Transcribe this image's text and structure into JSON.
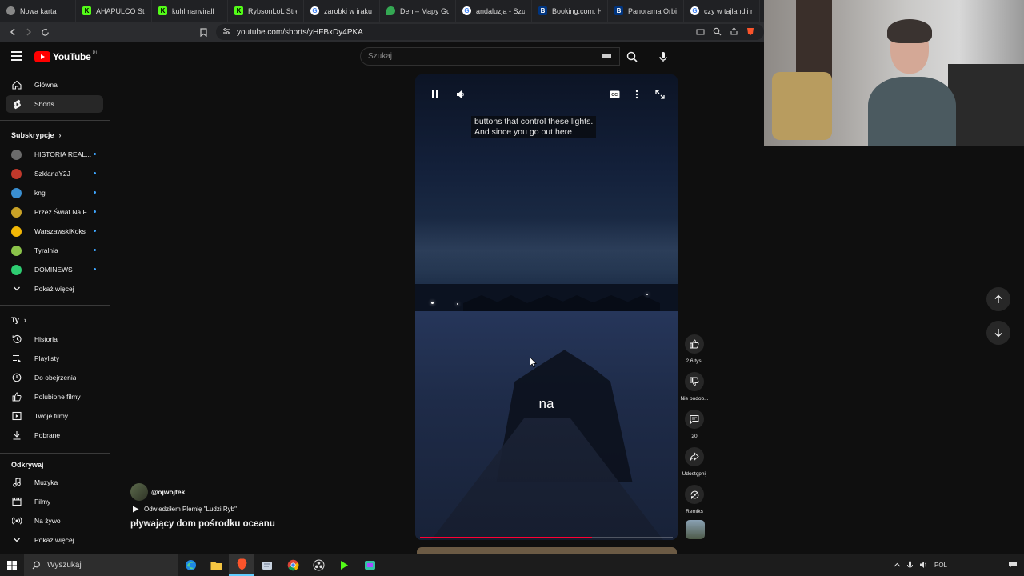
{
  "browser": {
    "tabs": [
      {
        "label": "Nowa karta",
        "icon": "brave-shield-icon"
      },
      {
        "label": "AHAPULCO Strea",
        "icon": "kick-icon"
      },
      {
        "label": "kuhlmanvirall",
        "icon": "kick-icon"
      },
      {
        "label": "RybsonLoL Strea",
        "icon": "kick-icon"
      },
      {
        "label": "zarobki w iraku -",
        "icon": "google-icon"
      },
      {
        "label": "Den – Mapy Goo",
        "icon": "maps-icon"
      },
      {
        "label": "andaluzja - Szuk",
        "icon": "google-icon"
      },
      {
        "label": "Booking.com: Ho",
        "icon": "booking-icon"
      },
      {
        "label": "Panorama Orbi C",
        "icon": "booking-icon"
      },
      {
        "label": "czy w tajlandii mo",
        "icon": "google-icon"
      }
    ],
    "url": "youtube.com/shorts/yHFBxDy4PKA"
  },
  "header": {
    "logo_text": "YouTube",
    "region": "PL",
    "search_placeholder": "Szukaj"
  },
  "sidebar": {
    "main": [
      {
        "label": "Główna",
        "icon": "home-icon"
      },
      {
        "label": "Shorts",
        "icon": "shorts-icon"
      }
    ],
    "subscriptions_title": "Subskrypcje",
    "subscriptions": [
      {
        "label": "HISTORIA REAL...",
        "color": "#6b6b6b"
      },
      {
        "label": "SzklanaY2J",
        "color": "#c0392b"
      },
      {
        "label": "kng",
        "color": "#3a8fd1"
      },
      {
        "label": "Przez Świat Na F...",
        "color": "#c9a227"
      },
      {
        "label": "WarszawskiKoks",
        "color": "#f2b705"
      },
      {
        "label": "Tyralnia",
        "color": "#8bc34a"
      },
      {
        "label": "DOMINEWS",
        "color": "#2ecc71"
      }
    ],
    "show_more_1": "Pokaż więcej",
    "you_title": "Ty",
    "you": [
      {
        "label": "Historia",
        "icon": "history-icon"
      },
      {
        "label": "Playlisty",
        "icon": "playlist-icon"
      },
      {
        "label": "Do obejrzenia",
        "icon": "clock-icon"
      },
      {
        "label": "Polubione filmy",
        "icon": "thumb-up-icon"
      },
      {
        "label": "Twoje filmy",
        "icon": "video-icon"
      },
      {
        "label": "Pobrane",
        "icon": "download-icon"
      }
    ],
    "explore_title": "Odkrywaj",
    "explore": [
      {
        "label": "Muzyka",
        "icon": "music-icon"
      },
      {
        "label": "Filmy",
        "icon": "film-icon"
      },
      {
        "label": "Na żywo",
        "icon": "live-icon"
      }
    ],
    "show_more_2": "Pokaż więcej"
  },
  "player": {
    "caption_top_line1": "buttons that control these lights.",
    "caption_top_line2": "And since you go out here",
    "caption_mid": "na",
    "progress": 0.68
  },
  "actions": {
    "like_count": "2,6 tys.",
    "dislike_label": "Nie podob...",
    "comments_count": "20",
    "share_label": "Udostępnij",
    "remix_label": "Remiks"
  },
  "video": {
    "channel": "@ojwojtek",
    "related": "Odwiedziłem Plemię \"Ludzi Ryb\"",
    "title": "pływający dom pośrodku oceanu"
  },
  "taskbar": {
    "search": "Wyszukaj",
    "lang": "POL"
  }
}
